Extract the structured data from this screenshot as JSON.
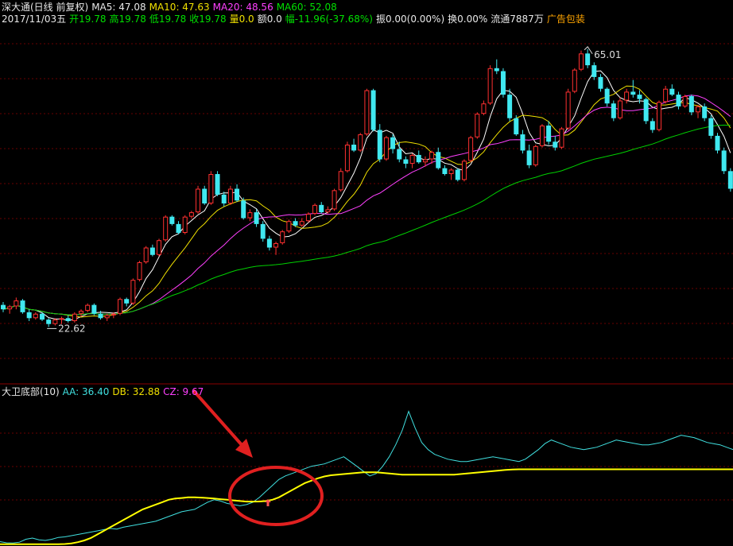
{
  "header": {
    "stock_name": "深大通(日线 前复权)",
    "ma5": "MA5: 47.08",
    "ma10": "MA10: 47.63",
    "ma20": "MA20: 48.56",
    "ma60": "MA60: 52.08",
    "date": "2017/11/03五",
    "open": "开19.78",
    "high": "高19.78",
    "low": "低19.78",
    "close": "收19.78",
    "volume": "量0.0",
    "amount": "额0.0",
    "change": "幅-11.96(-37.68%)",
    "amplitude": "振0.00(0.00%)",
    "turnover": "换0.00%",
    "float_shares": "流通7887万",
    "ad_link": "广告包装"
  },
  "indicator_header": {
    "name": "大卫底部(10)",
    "aa": "AA: 36.40",
    "db": "DB: 32.88",
    "cz": "CZ: 9.67"
  },
  "colors": {
    "up": "#ff3030",
    "down": "#40e8f0",
    "ma5": "#ffffff",
    "ma10": "#f0e000",
    "ma20": "#ff40ff",
    "ma60": "#00d000",
    "aa": "#40e0e0",
    "db": "#ffff00",
    "annotation": "#e02020",
    "grid": "#6a0000"
  },
  "chart_data": [
    {
      "type": "candlestick",
      "annotations": [
        {
          "label": "65.01",
          "kind": "high"
        },
        {
          "label": "22.62",
          "kind": "low"
        }
      ],
      "candles": [
        [
          40.5,
          41.5,
          38,
          39
        ],
        [
          39,
          40.5,
          37.5,
          40
        ],
        [
          40,
          43,
          39,
          42
        ],
        [
          42,
          42.5,
          37.5,
          38
        ],
        [
          38,
          39,
          35,
          36
        ],
        [
          36,
          38,
          35.5,
          37.5
        ],
        [
          37.5,
          38,
          35,
          35.5
        ],
        [
          35.5,
          36,
          33,
          34
        ],
        [
          34,
          36,
          33.5,
          35.5
        ],
        [
          35.5,
          36.5,
          34,
          36
        ],
        [
          36,
          37,
          34.5,
          35
        ],
        [
          35,
          38,
          34.5,
          37.5
        ],
        [
          37.5,
          39,
          36.5,
          38.5
        ],
        [
          38.5,
          41,
          38,
          40.5
        ],
        [
          40.5,
          41,
          37,
          37.5
        ],
        [
          37.5,
          38.5,
          35.5,
          36
        ],
        [
          36,
          37.5,
          35,
          37
        ],
        [
          37,
          38,
          36,
          37.5
        ],
        [
          37.5,
          43,
          37,
          42.5
        ],
        [
          42.5,
          43,
          40,
          41
        ],
        [
          41,
          49.5,
          40.5,
          49
        ],
        [
          49,
          55.5,
          48.5,
          55
        ],
        [
          55,
          60.5,
          54.5,
          60
        ],
        [
          60,
          61,
          57,
          57.5
        ],
        [
          57.5,
          63,
          57,
          62.5
        ],
        [
          62.5,
          71,
          62,
          70.5
        ],
        [
          70.5,
          71,
          67.5,
          68
        ],
        [
          68,
          69,
          64.5,
          65
        ],
        [
          65,
          71,
          64.5,
          70.5
        ],
        [
          70.5,
          72.5,
          70,
          72
        ],
        [
          72,
          81,
          71.5,
          80
        ],
        [
          80,
          81,
          74.5,
          75
        ],
        [
          75,
          86,
          74.5,
          85
        ],
        [
          85,
          86,
          77.5,
          78
        ],
        [
          78,
          79,
          74,
          75
        ],
        [
          75,
          81,
          74.5,
          80
        ],
        [
          80,
          81.5,
          75.5,
          76
        ],
        [
          76,
          77,
          69.5,
          70
        ],
        [
          70,
          73,
          69,
          72
        ],
        [
          72,
          73,
          67,
          68
        ],
        [
          68,
          69,
          62,
          63
        ],
        [
          63,
          64,
          59,
          60
        ],
        [
          60,
          62,
          57.5,
          61.5
        ],
        [
          61.5,
          66,
          61,
          65.5
        ],
        [
          65.5,
          69.5,
          65,
          69
        ],
        [
          69,
          70,
          67,
          67.5
        ],
        [
          67.5,
          70,
          67,
          69
        ],
        [
          69,
          72,
          68.5,
          71.5
        ],
        [
          71.5,
          75,
          71,
          74.5
        ],
        [
          74.5,
          75.5,
          71.5,
          72
        ],
        [
          72,
          74,
          71.5,
          73
        ],
        [
          73,
          80,
          72.5,
          79.5
        ],
        [
          79.5,
          87,
          79,
          86
        ],
        [
          86,
          96,
          85.5,
          95
        ],
        [
          95,
          97,
          92.5,
          93
        ],
        [
          93,
          99,
          92.5,
          98.5
        ],
        [
          98.5,
          114,
          98,
          113.5
        ],
        [
          113.5,
          114,
          99.5,
          100
        ],
        [
          100,
          102,
          89,
          90
        ],
        [
          90,
          98,
          89.5,
          97.5
        ],
        [
          97.5,
          98.5,
          92,
          93.5
        ],
        [
          93.5,
          96,
          89,
          90
        ],
        [
          90,
          91,
          87,
          88.5
        ],
        [
          88.5,
          92,
          87,
          91.5
        ],
        [
          91.5,
          93,
          88.5,
          89
        ],
        [
          89,
          91,
          87.5,
          90
        ],
        [
          90,
          93,
          88.5,
          92.5
        ],
        [
          92.5,
          94,
          86.5,
          87
        ],
        [
          87,
          88,
          84.5,
          85
        ],
        [
          85,
          87,
          83,
          86.5
        ],
        [
          86.5,
          87,
          82.5,
          83
        ],
        [
          83,
          90,
          82.5,
          89.5
        ],
        [
          89.5,
          98,
          89,
          97.5
        ],
        [
          97.5,
          106,
          97,
          105.5
        ],
        [
          105.5,
          110,
          105,
          109
        ],
        [
          109,
          122,
          108.5,
          121
        ],
        [
          121,
          124,
          119,
          120
        ],
        [
          120,
          121,
          111,
          112
        ],
        [
          112,
          114,
          103,
          104
        ],
        [
          104,
          105,
          98,
          98.5
        ],
        [
          98.5,
          100,
          92,
          93
        ],
        [
          93,
          95,
          87,
          88
        ],
        [
          88,
          95,
          87.5,
          94.5
        ],
        [
          94.5,
          102,
          94,
          101.5
        ],
        [
          101.5,
          103,
          95,
          96
        ],
        [
          96,
          98,
          93,
          94
        ],
        [
          94,
          101,
          93.5,
          100.5
        ],
        [
          100.5,
          114,
          100,
          113
        ],
        [
          113,
          121,
          112.5,
          120.5
        ],
        [
          120.5,
          127,
          120,
          126
        ],
        [
          126,
          127.5,
          121,
          122
        ],
        [
          122,
          123,
          117,
          118
        ],
        [
          118,
          119,
          113,
          114
        ],
        [
          114,
          114.5,
          108,
          109
        ],
        [
          109,
          110,
          103,
          104
        ],
        [
          104,
          111,
          103.5,
          110
        ],
        [
          110,
          114,
          109,
          113
        ],
        [
          113,
          117,
          111,
          112
        ],
        [
          112,
          113.5,
          109,
          110.5
        ],
        [
          110.5,
          111,
          102,
          103
        ],
        [
          103,
          104,
          99,
          100
        ],
        [
          100,
          110,
          99.5,
          109.5
        ],
        [
          109.5,
          115,
          109,
          114
        ],
        [
          114,
          115.5,
          111.5,
          112
        ],
        [
          112,
          113,
          107,
          108
        ],
        [
          108,
          112,
          107.5,
          111.5
        ],
        [
          111.5,
          112,
          105,
          106
        ],
        [
          106,
          108.5,
          104,
          108
        ],
        [
          108,
          109,
          103,
          104
        ],
        [
          104,
          105,
          97,
          98
        ],
        [
          98,
          99,
          92,
          93
        ],
        [
          93,
          94,
          85,
          86
        ],
        [
          86,
          87,
          79,
          80
        ]
      ]
    },
    {
      "type": "line",
      "aa": [
        3,
        2,
        1.8,
        2.5,
        5,
        6,
        4.5,
        4,
        5,
        6.5,
        7,
        8,
        9,
        10,
        11,
        12,
        13,
        14,
        13.5,
        15,
        16,
        17,
        18,
        19,
        20,
        22,
        24,
        26,
        28,
        29,
        30,
        33,
        36,
        38,
        37,
        35,
        34,
        33,
        34,
        36,
        40,
        45,
        50,
        55,
        58,
        60,
        62,
        64,
        66,
        67,
        68,
        70,
        72,
        74,
        70,
        66,
        62,
        58,
        60,
        66,
        74,
        84,
        96,
        112,
        98,
        86,
        80,
        76,
        74,
        72,
        71,
        70,
        70,
        71,
        72,
        73,
        74,
        73,
        72,
        71,
        70,
        72,
        76,
        80,
        85,
        88,
        86,
        84,
        82,
        81,
        80,
        81,
        82,
        84,
        86,
        88,
        87,
        86,
        85,
        84,
        84,
        85,
        86,
        88,
        90,
        92,
        91,
        90,
        88,
        86,
        85,
        84,
        82,
        80
      ],
      "db": [
        0.8,
        0.8,
        0.8,
        0.8,
        0.8,
        0.8,
        0.8,
        0.8,
        0.8,
        0.8,
        1,
        1.5,
        2.5,
        4,
        6,
        9,
        12,
        15,
        18,
        21,
        24,
        27,
        30,
        32,
        34,
        36,
        38,
        39,
        39.5,
        40,
        40,
        39.8,
        39.5,
        39,
        38.5,
        38,
        37.5,
        37,
        36.5,
        36.5,
        36.6,
        37,
        38,
        40,
        43,
        46,
        49,
        52,
        54,
        56,
        57.5,
        58.5,
        59,
        59.5,
        60,
        60.5,
        61,
        61,
        61,
        60.5,
        60,
        59.5,
        59,
        59,
        59,
        59,
        59,
        59,
        59,
        59,
        59,
        59.5,
        60,
        60.5,
        61,
        61.5,
        62,
        62.5,
        63,
        63.3,
        63.5,
        63.5,
        63.5,
        63.5,
        63.5,
        63.5,
        63.5,
        63.5,
        63.5,
        63.5,
        63.5,
        63.5,
        63.5,
        63.5,
        63.5,
        63.5,
        63.5,
        63.5,
        63.5,
        63.5,
        63.5,
        63.5,
        63.5,
        63.5,
        63.5,
        63.5,
        63.5,
        63.5,
        63.5,
        63.5,
        63.5,
        63.5,
        63.5,
        63.5
      ]
    }
  ]
}
